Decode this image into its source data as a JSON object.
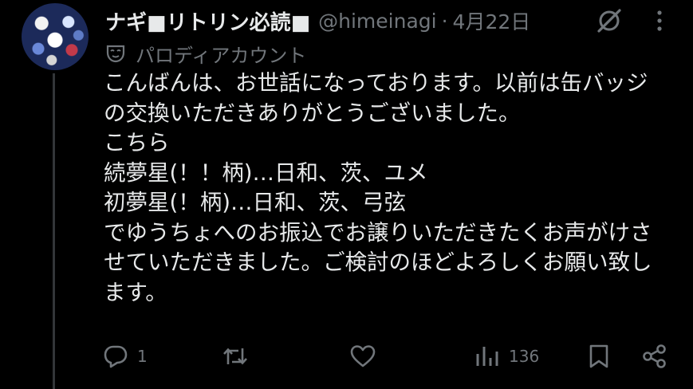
{
  "tweet": {
    "display_name": "ナギ■リトリン必読■",
    "handle": "@himeinagi",
    "separator": "·",
    "date": "4月22日",
    "label": "パロディアカウント",
    "body_lines": [
      "こんばんは、お世話になっております。以前は缶バッジ",
      "の交換いただきありがとうございました。",
      "こちら",
      "続夢星(！！柄)…日和、茨、ユメ",
      "初夢星(！柄)…日和、茨、弓弦",
      "でゆうちょへのお振込でお譲りいただきたくお声がけさ",
      "せていただきました。ご検討のほどよろしくお願い致し",
      "ます。"
    ]
  },
  "actions": {
    "reply_count": "1",
    "retweet_count": "",
    "like_count": "",
    "view_count": "136"
  },
  "icons": {
    "grok": "grok-icon",
    "more": "more-icon",
    "parody": "mask-icon",
    "reply": "reply-icon",
    "retweet": "retweet-icon",
    "like": "heart-icon",
    "views": "views-icon",
    "bookmark": "bookmark-icon",
    "share": "share-icon"
  },
  "colors": {
    "background": "#000000",
    "text": "#e7e9ea",
    "muted": "#71767b",
    "thread_line": "#333639"
  }
}
